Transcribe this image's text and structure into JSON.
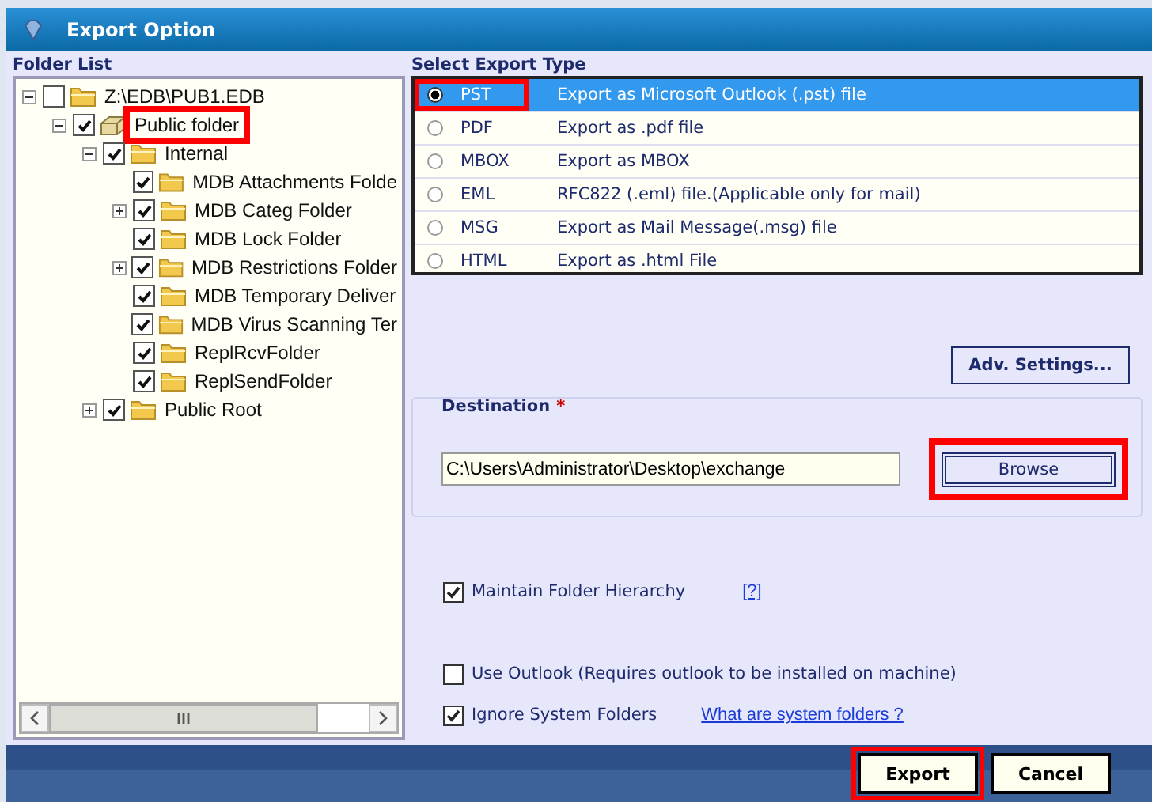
{
  "window": {
    "title": "Export Option"
  },
  "folder_list": {
    "label": "Folder List",
    "tree": [
      {
        "name": "Z:\\EDB\\PUB1.EDB",
        "kind": "branch",
        "checked": false,
        "expanded": true,
        "highlighted": false,
        "children": [
          {
            "name": "Public folder",
            "kind": "branch",
            "checked": true,
            "expanded": true,
            "highlighted": true,
            "children": [
              {
                "name": "Internal",
                "kind": "branch",
                "checked": true,
                "expanded": true,
                "highlighted": false,
                "children": [
                  {
                    "name": "MDB Attachments Folde",
                    "kind": "leaf",
                    "checked": true,
                    "highlighted": false
                  },
                  {
                    "name": "MDB Categ Folder",
                    "kind": "branch",
                    "checked": true,
                    "expanded": false,
                    "highlighted": false
                  },
                  {
                    "name": "MDB Lock Folder",
                    "kind": "leaf",
                    "checked": true,
                    "highlighted": false
                  },
                  {
                    "name": "MDB Restrictions Folder",
                    "kind": "branch",
                    "checked": true,
                    "expanded": false,
                    "highlighted": false
                  },
                  {
                    "name": "MDB Temporary Deliver",
                    "kind": "leaf",
                    "checked": true,
                    "highlighted": false
                  },
                  {
                    "name": "MDB Virus Scanning Ter",
                    "kind": "leaf",
                    "checked": true,
                    "highlighted": false
                  },
                  {
                    "name": "ReplRcvFolder",
                    "kind": "leaf",
                    "checked": true,
                    "highlighted": false
                  },
                  {
                    "name": "ReplSendFolder",
                    "kind": "leaf",
                    "checked": true,
                    "highlighted": false
                  }
                ]
              },
              {
                "name": "Public Root",
                "kind": "branch",
                "checked": true,
                "expanded": false,
                "highlighted": false
              }
            ]
          }
        ]
      }
    ]
  },
  "export_type": {
    "label": "Select Export Type",
    "options": [
      {
        "name": "PST",
        "description": "Export as Microsoft Outlook (.pst) file",
        "selected": true,
        "highlighted": true
      },
      {
        "name": "PDF",
        "description": "Export as .pdf file",
        "selected": false,
        "highlighted": false
      },
      {
        "name": "MBOX",
        "description": "Export as MBOX",
        "selected": false,
        "highlighted": false
      },
      {
        "name": "EML",
        "description": "RFC822 (.eml) file.(Applicable only for mail)",
        "selected": false,
        "highlighted": false
      },
      {
        "name": "MSG",
        "description": "Export as Mail Message(.msg) file",
        "selected": false,
        "highlighted": false
      },
      {
        "name": "HTML",
        "description": "Export as .html File",
        "selected": false,
        "highlighted": false
      }
    ]
  },
  "adv_settings_button": "Adv. Settings...",
  "destination": {
    "label": "Destination",
    "required_mark": "*",
    "path": "C:\\Users\\Administrator\\Desktop\\exchange",
    "browse_button": {
      "label": "Browse",
      "highlighted": true
    }
  },
  "options": [
    {
      "label": "Maintain Folder Hierarchy",
      "checked": true,
      "help_link": "[?]"
    },
    {
      "label": "Use Outlook (Requires outlook to be installed on machine)",
      "checked": false
    },
    {
      "label": "Ignore System Folders",
      "checked": true,
      "help_link": "What are system folders ?"
    }
  ],
  "buttons": [
    {
      "label": "Export",
      "highlighted": true
    },
    {
      "label": "Cancel",
      "highlighted": false
    }
  ]
}
